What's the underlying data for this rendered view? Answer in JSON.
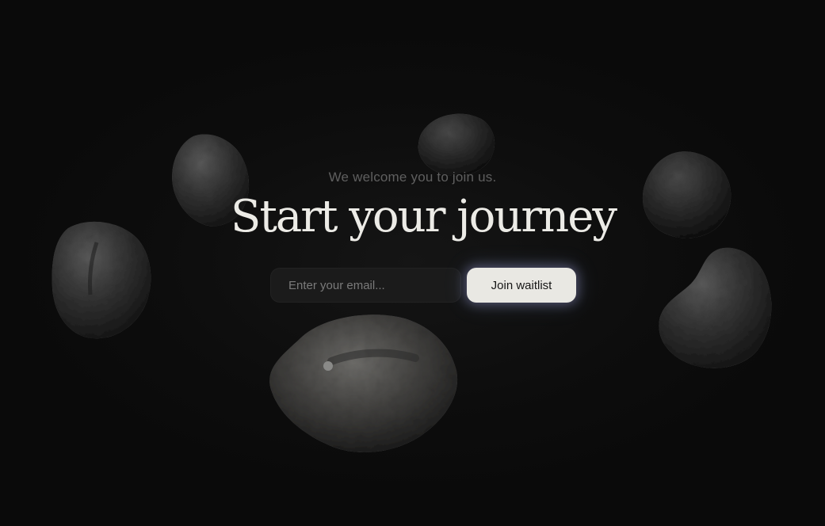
{
  "hero": {
    "tagline": "We welcome you to join us.",
    "title": "Start your journey"
  },
  "form": {
    "email_placeholder": "Enter your email...",
    "submit_label": "Join waitlist"
  },
  "theme": {
    "background": "#0b0b0b",
    "text_primary": "#ecebe6",
    "text_muted": "#5f5f5f",
    "button_bg": "#e9e8e3",
    "input_bg": "#1b1b1b"
  },
  "decorations": {
    "rocks": [
      "rock-icon",
      "rock-icon",
      "rock-icon",
      "rock-icon",
      "rock-icon",
      "rock-icon",
      "rock-icon"
    ]
  }
}
